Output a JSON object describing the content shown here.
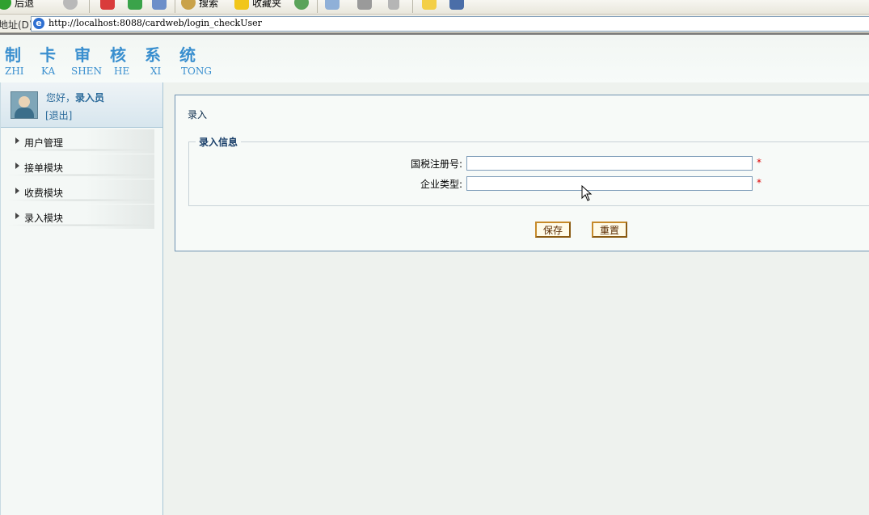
{
  "browser": {
    "toolbar": {
      "back_label": "后退",
      "search_label": "搜索",
      "favorites_label": "收藏夹"
    },
    "address_label": "地址(D)",
    "url": "http://localhost:8088/cardweb/login_checkUser"
  },
  "header": {
    "title_chars": [
      "制",
      "卡",
      "审",
      "核",
      "系",
      "统"
    ],
    "title_pinyin": [
      "ZHI",
      "KA",
      "SHEN",
      "HE",
      "XI",
      "TONG"
    ]
  },
  "sidebar": {
    "greeting_prefix": "您好，",
    "user_role": "录入员",
    "logout_label": "[退出]",
    "items": [
      {
        "label": "用户管理"
      },
      {
        "label": "接单模块"
      },
      {
        "label": "收费模块"
      },
      {
        "label": "录入模块"
      }
    ]
  },
  "main": {
    "panel_title": "录入",
    "legend": "录入信息",
    "fields": [
      {
        "label": "国税注册号:",
        "value": "",
        "required_mark": "*"
      },
      {
        "label": "企业类型:",
        "value": "",
        "required_mark": "*"
      }
    ],
    "save_label": "保存",
    "reset_label": "重置"
  },
  "colors": {
    "accent": "#3a8fcf",
    "panel_border": "#6f93b1",
    "button_border": "#c68a2a",
    "required": "#dd0000"
  }
}
